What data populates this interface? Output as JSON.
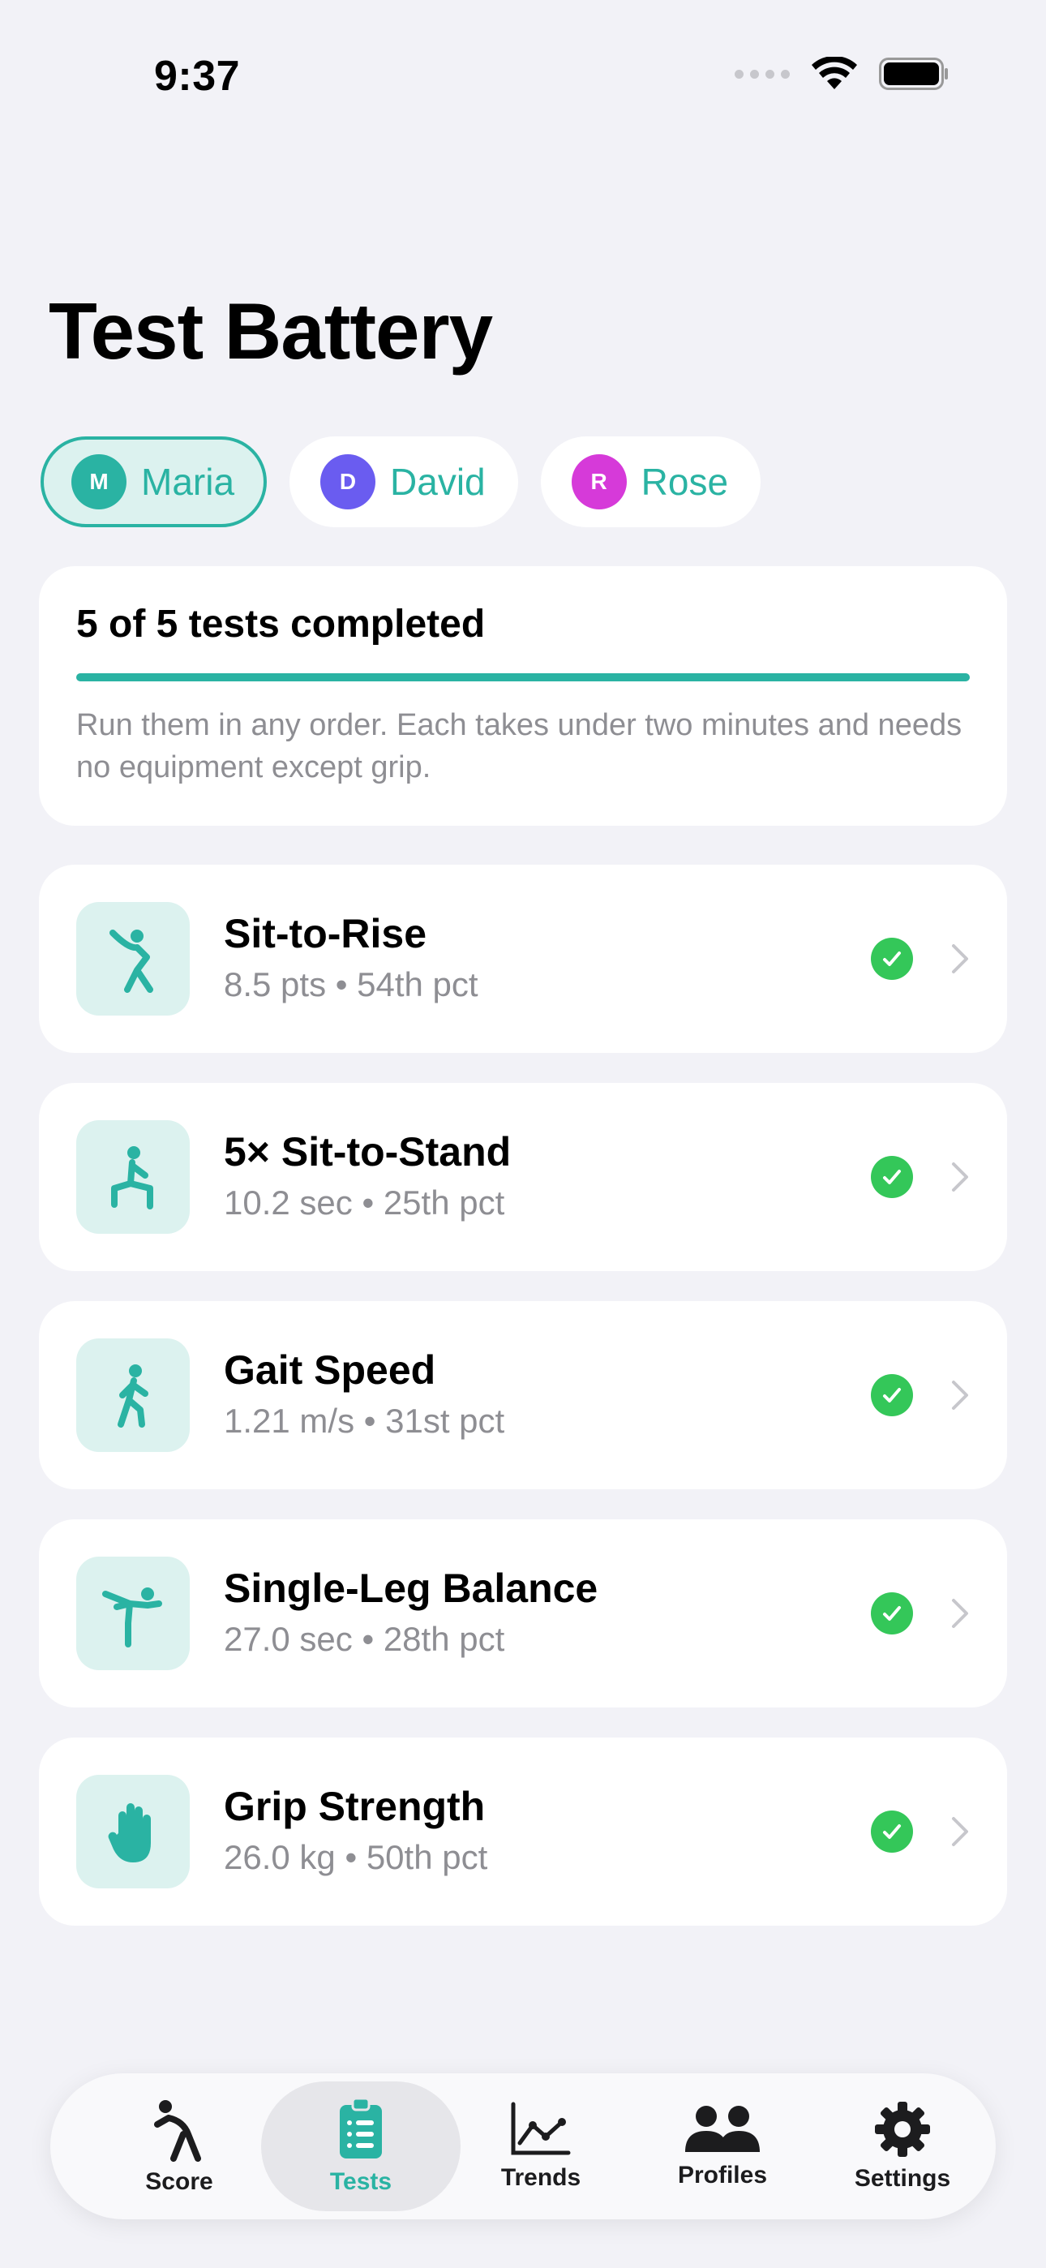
{
  "status_bar": {
    "time": "9:37"
  },
  "page_title": "Test Battery",
  "profiles": [
    {
      "initial": "M",
      "name": "Maria",
      "active": true,
      "color": "#2ab3a3"
    },
    {
      "initial": "D",
      "name": "David",
      "active": false,
      "color": "#6a5cf0"
    },
    {
      "initial": "R",
      "name": "Rose",
      "active": false,
      "color": "#d63ad9"
    }
  ],
  "progress": {
    "title": "5 of 5 tests completed",
    "completed": 5,
    "total": 5,
    "description": "Run them in any order. Each takes under two minutes and needs no equipment except grip."
  },
  "tests": [
    {
      "name": "Sit-to-Rise",
      "meta": "8.5 pts • 54th pct",
      "icon": "stretch-figure-icon",
      "completed": true
    },
    {
      "name": "5× Sit-to-Stand",
      "meta": "10.2 sec • 25th pct",
      "icon": "lunge-figure-icon",
      "completed": true
    },
    {
      "name": "Gait Speed",
      "meta": "1.21 m/s • 31st pct",
      "icon": "walking-figure-icon",
      "completed": true
    },
    {
      "name": "Single-Leg Balance",
      "meta": "27.0 sec • 28th pct",
      "icon": "balance-figure-icon",
      "completed": true
    },
    {
      "name": "Grip Strength",
      "meta": "26.0 kg • 50th pct",
      "icon": "hand-icon",
      "completed": true
    }
  ],
  "tab_bar": {
    "tabs": [
      {
        "label": "Score",
        "icon": "figure-run-icon",
        "active": false
      },
      {
        "label": "Tests",
        "icon": "clipboard-list-icon",
        "active": true
      },
      {
        "label": "Trends",
        "icon": "line-chart-icon",
        "active": false
      },
      {
        "label": "Profiles",
        "icon": "people-icon",
        "active": false
      },
      {
        "label": "Settings",
        "icon": "gear-icon",
        "active": false
      }
    ]
  },
  "colors": {
    "accent": "#2ab3a3",
    "accent_light": "#dcf2ef",
    "check_green": "#34c759",
    "background": "#f2f2f7",
    "secondary_text": "#8e8e93"
  }
}
